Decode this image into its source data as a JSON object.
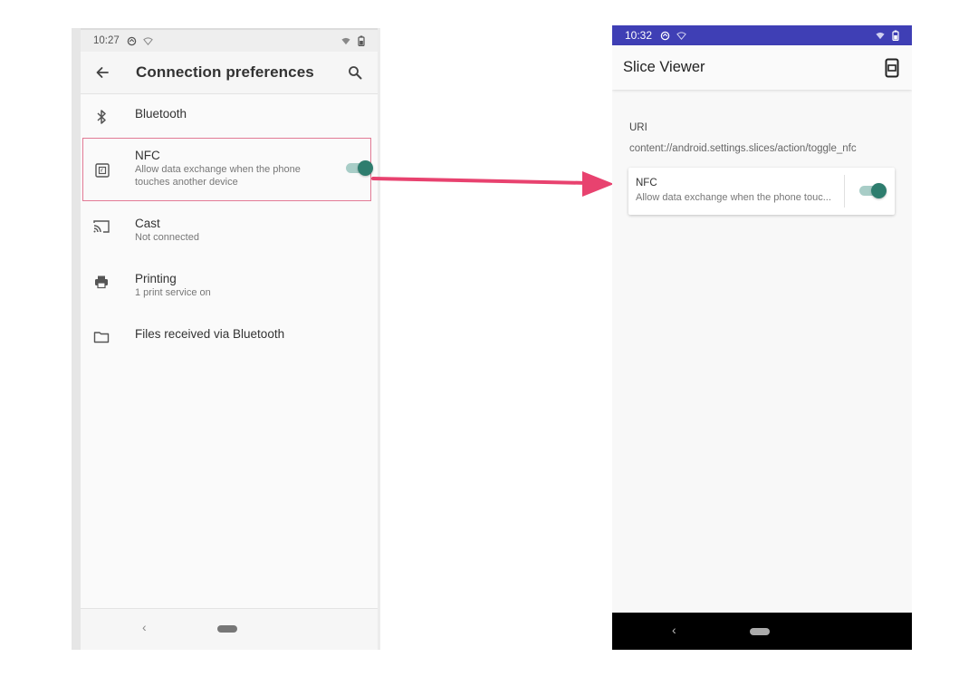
{
  "left_phone": {
    "status_bar": {
      "time": "10:27"
    },
    "app_bar": {
      "title": "Connection preferences"
    },
    "items": [
      {
        "title": "Bluetooth",
        "subtitle": ""
      },
      {
        "title": "NFC",
        "subtitle_line1": "Allow data exchange when the phone",
        "subtitle_line2": "touches another device",
        "toggle_on": true
      },
      {
        "title": "Cast",
        "subtitle": "Not connected"
      },
      {
        "title": "Printing",
        "subtitle": "1 print service on"
      },
      {
        "title": "Files received via Bluetooth",
        "subtitle": ""
      }
    ],
    "nav": {
      "back_glyph": "‹"
    }
  },
  "right_phone": {
    "status_bar": {
      "time": "10:32",
      "color": "#3f3fb5"
    },
    "app_bar": {
      "title": "Slice Viewer"
    },
    "uri_label": "URI",
    "uri_value": "content://android.settings.slices/action/toggle_nfc",
    "slice": {
      "title": "NFC",
      "subtitle": "Allow data exchange when the phone touc...",
      "toggle_on": true
    },
    "nav": {
      "back_glyph": "‹"
    }
  },
  "colors": {
    "highlight_border": "#e27a95",
    "arrow": "#e8426f",
    "toggle_thumb": "#2e7d6e",
    "toggle_track": "#a8cdc7"
  }
}
